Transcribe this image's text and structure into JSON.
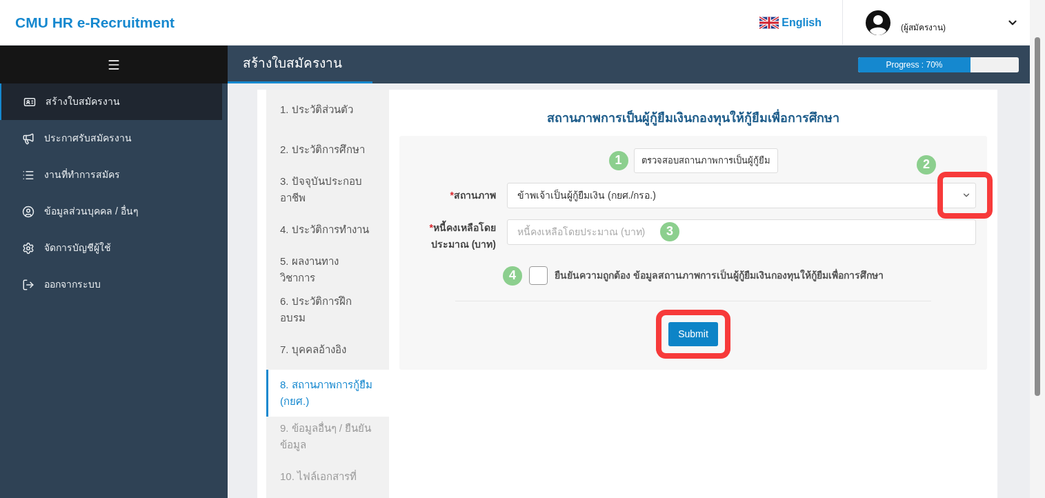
{
  "header": {
    "logo": "CMU HR e-Recruitment",
    "language": "English",
    "user_role": "(ผู้สมัครงาน)"
  },
  "sidebar": {
    "items": [
      {
        "label": "สร้างใบสมัครงาน",
        "selected": true
      },
      {
        "label": "ประกาศรับสมัครงาน",
        "selected": false
      },
      {
        "label": "งานที่ทำการสมัคร",
        "selected": false
      },
      {
        "label": "ข้อมูลส่วนบุคคล / อื่นๆ",
        "selected": false
      },
      {
        "label": "จัดการบัญชีผู้ใช้",
        "selected": false
      },
      {
        "label": "ออกจากระบบ",
        "selected": false
      }
    ]
  },
  "page_title": "สร้างใบสมัครงาน",
  "progress": {
    "label": "Progress : 70%",
    "level": 0.7
  },
  "steps": [
    {
      "label": "1. ประวัติส่วนตัว",
      "selected": false,
      "disabled": false
    },
    {
      "label": "2. ประวัติการศึกษา",
      "selected": false,
      "disabled": false
    },
    {
      "label": "3. ปัจจุบันประกอบอาชีพ",
      "selected": false,
      "disabled": false
    },
    {
      "label": "4. ประวัติการทำงาน",
      "selected": false,
      "disabled": false
    },
    {
      "label": "5. ผลงานทางวิชาการ",
      "selected": false,
      "disabled": false
    },
    {
      "label": "6. ประวัติการฝึกอบรม",
      "selected": false,
      "disabled": false
    },
    {
      "label": "7. บุคคลอ้างอิง",
      "selected": false,
      "disabled": false
    },
    {
      "label": "8. สถานภาพการกู้ยืม (กยศ.)",
      "selected": true,
      "disabled": false
    },
    {
      "label": "9. ข้อมูลอื่นๆ / ยืนยันข้อมูล",
      "selected": false,
      "disabled": true
    },
    {
      "label": "10. ไฟล์เอกสารที่",
      "selected": false,
      "disabled": true
    }
  ],
  "form": {
    "title": "สถานภาพการเป็นผู้กู้ยืมเงินกองทุนให้กู้ยืมเพื่อการศึกษา",
    "check_button": {
      "label": "ตรวจสอบสถานภาพการเป็นผู้กู้ยืม",
      "marker": "1"
    },
    "status": {
      "required_mark": "*",
      "label": "สถานภาพ",
      "value": "ข้าพเจ้าเป็นผู้กู้ยืมเงิน (กยศ./กรอ.)",
      "marker": "2",
      "highlighted": true
    },
    "debt": {
      "required_mark": "*",
      "label": "หนี้คงเหลือโดยประมาณ (บาท)",
      "placeholder": "หนี้คงเหลือโดยประมาณ (บาท)",
      "marker": "3"
    },
    "confirm": {
      "label": "ยืนยันความถูกต้อง ข้อมูลสถานภาพการเป็นผู้กู้ยืมเงินกองทุนให้กู้ยืมเพื่อการศึกษา",
      "checked": false,
      "marker": "4"
    },
    "submit": {
      "label": "Submit",
      "highlighted": true
    }
  }
}
